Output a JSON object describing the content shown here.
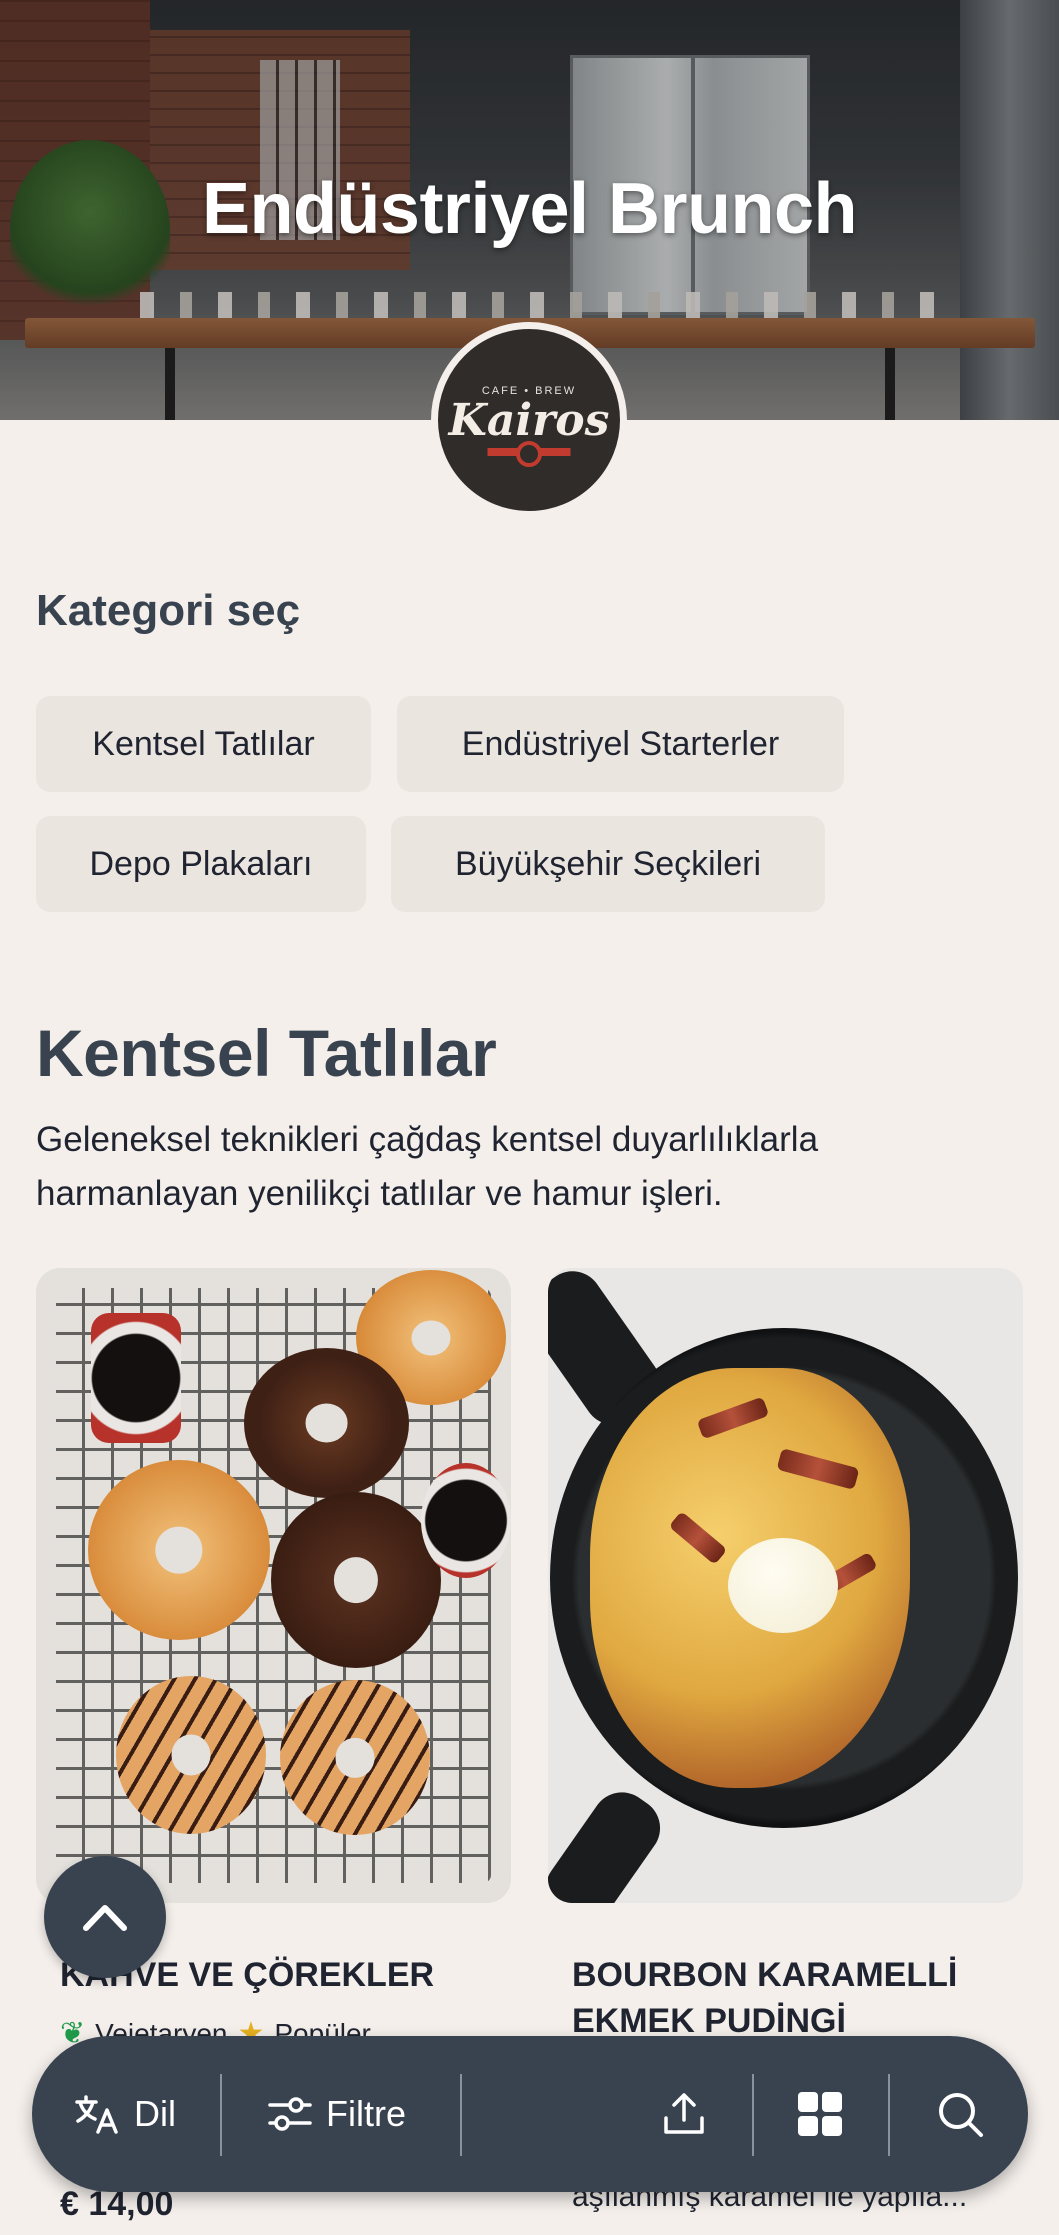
{
  "hero": {
    "title": "Endüstriyel Brunch",
    "logo": {
      "top": "CAFE • BREW",
      "name": "Kairos"
    }
  },
  "categories": {
    "heading": "Kategori seç",
    "items": [
      "Kentsel Tatlılar",
      "Endüstriyel Starterler",
      "Depo Plakaları",
      "Büyükşehir Seçkileri"
    ]
  },
  "section": {
    "title": "Kentsel Tatlılar",
    "description": "Geleneksel teknikleri çağdaş kentsel duyarlılıklarla harmanlayan yenilikçi tatlılar ve hamur işleri."
  },
  "products": [
    {
      "title": "KAHVE VE ÇÖREKLER",
      "tags": [
        "Vejetaryen",
        "Popüler"
      ],
      "price": "€ 14,00"
    },
    {
      "title": "BOURBON KARAMELLİ EKMEK PUDİNGİ",
      "description": "aşılanmış karamel ile yapıla..."
    }
  ],
  "bottom_bar": {
    "language": "Dil",
    "filter": "Filtre",
    "icons": [
      "translate-icon",
      "filter-icon",
      "share-icon",
      "grid-icon",
      "search-icon"
    ]
  },
  "colors": {
    "background": "#f4efeb",
    "accent": "#394350",
    "chip": "#ebe5e0",
    "veg": "#1f9a4a",
    "star": "#e6b020"
  }
}
